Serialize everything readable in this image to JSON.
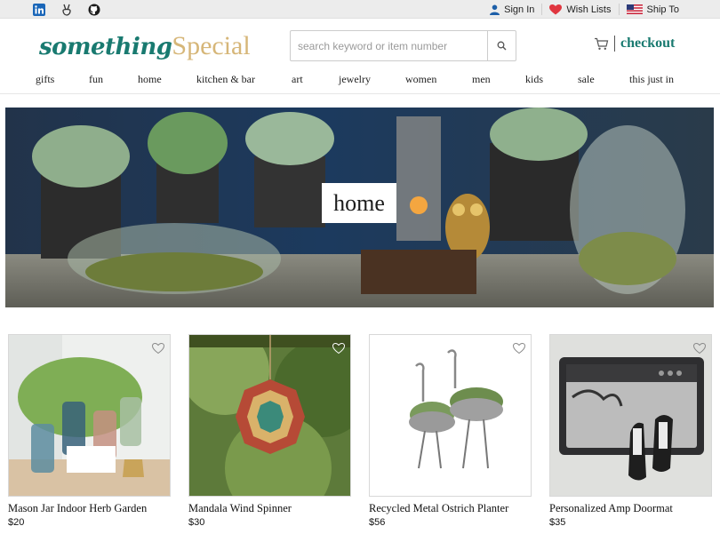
{
  "topbar": {
    "social": [
      "linkedin-icon",
      "angellist-icon",
      "github-icon"
    ],
    "signin": "Sign In",
    "wishlists": "Wish Lists",
    "shipto": "Ship To"
  },
  "header": {
    "logo_part1": "something",
    "logo_part2": "Special",
    "search_placeholder": "search keyword or item number",
    "checkout": "checkout"
  },
  "nav": [
    "gifts",
    "fun",
    "home",
    "kitchen & bar",
    "art",
    "jewelry",
    "women",
    "men",
    "kids",
    "sale",
    "this just in"
  ],
  "hero": {
    "label": "home"
  },
  "products": [
    {
      "name": "Mason Jar Indoor Herb Garden",
      "price": "$20"
    },
    {
      "name": "Mandala Wind Spinner",
      "price": "$30"
    },
    {
      "name": "Recycled Metal Ostrich Planter",
      "price": "$56"
    },
    {
      "name": "Personalized Amp Doormat",
      "price": "$35"
    }
  ],
  "colors": {
    "brand_teal": "#197a70",
    "brand_gold": "#d6b678",
    "heart_red": "#e0363f"
  }
}
